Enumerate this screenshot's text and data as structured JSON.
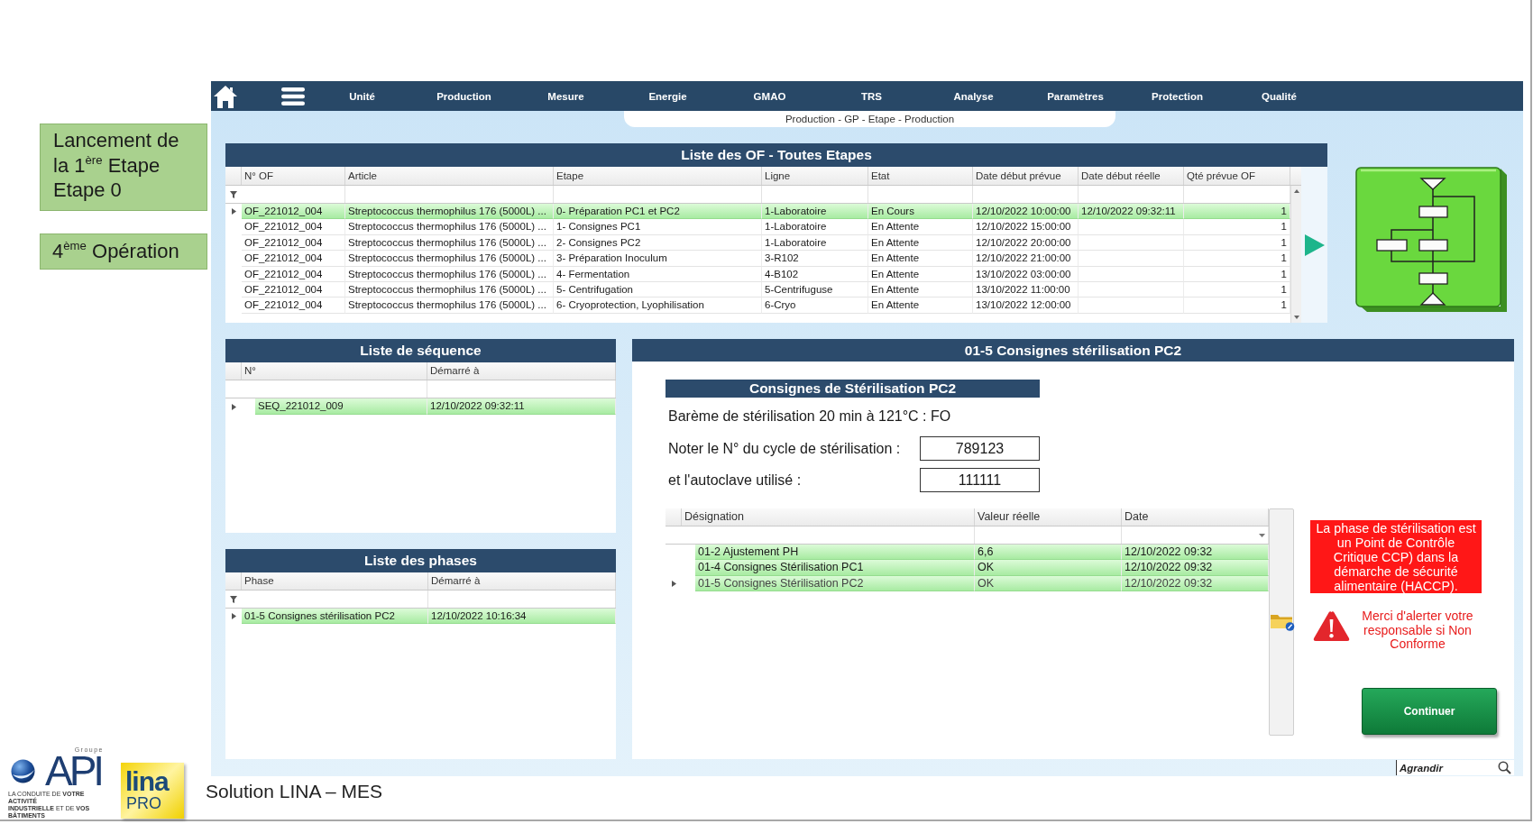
{
  "notes": {
    "step": {
      "title": "Lancement de la 1$^{ère}$ Etape",
      "subtitle": "Etape 0"
    },
    "operation": "4$^{ème}$ Opération"
  },
  "nav": {
    "items": [
      "Unité",
      "Production",
      "Mesure",
      "Energie",
      "GMAO",
      "TRS",
      "Analyse",
      "Paramètres",
      "Protection",
      "Qualité"
    ]
  },
  "breadcrumb": "Production - GP - Etape - Production",
  "of_list": {
    "title": "Liste des OF - Toutes Etapes",
    "columns": [
      "N° OF",
      "Article",
      "Etape",
      "Ligne",
      "Etat",
      "Date début prévue",
      "Date début réelle",
      "Qté prévue OF"
    ],
    "rows": [
      {
        "of": "OF_221012_004",
        "article": "Streptococcus thermophilus 176 (5000L) ...",
        "step": "0- Préparation PC1 et PC2",
        "line": "1-Laboratoire",
        "status": "En Cours",
        "planned_start": "12/10/2022 10:00:00",
        "actual_start": "12/10/2022 09:32:11",
        "planned_qty": "1",
        "selected": true
      },
      {
        "of": "OF_221012_004",
        "article": "Streptococcus thermophilus 176 (5000L) ...",
        "step": "1- Consignes PC1",
        "line": "1-Laboratoire",
        "status": "En Attente",
        "planned_start": "12/10/2022 15:00:00",
        "planned_qty": "1",
        "selected": false
      },
      {
        "of": "OF_221012_004",
        "article": "Streptococcus thermophilus 176 (5000L) ...",
        "step": "2- Consignes PC2",
        "line": "1-Laboratoire",
        "status": "En Attente",
        "planned_start": "12/10/2022 20:00:00",
        "planned_qty": "1",
        "selected": false
      },
      {
        "of": "OF_221012_004",
        "article": "Streptococcus thermophilus 176 (5000L) ...",
        "step": "3- Préparation Inoculum",
        "line": "3-R102",
        "status": "En Attente",
        "planned_start": "12/10/2022 21:00:00",
        "planned_qty": "1",
        "selected": false
      },
      {
        "of": "OF_221012_004",
        "article": "Streptococcus thermophilus 176 (5000L) ...",
        "step": "4- Fermentation",
        "line": "4-B102",
        "status": "En Attente",
        "planned_start": "13/10/2022 03:00:00",
        "planned_qty": "1",
        "selected": false
      },
      {
        "of": "OF_221012_004",
        "article": "Streptococcus thermophilus 176 (5000L) ...",
        "step": "5- Centrifugation",
        "line": "5-Centrifuguse",
        "status": "En Attente",
        "planned_start": "13/10/2022 11:00:00",
        "planned_qty": "1",
        "selected": false
      },
      {
        "of": "OF_221012_004",
        "article": "Streptococcus thermophilus 176 (5000L) ...",
        "step": "6- Cryoprotection, Lyophilisation",
        "line": "6-Cryo",
        "status": "En Attente",
        "planned_start": "13/10/2022 12:00:00",
        "planned_qty": "1",
        "selected": false
      }
    ]
  },
  "sequence_list": {
    "title": "Liste de séquence",
    "columns": [
      "N°",
      "Démarré à"
    ],
    "rows": [
      {
        "number": "SEQ_221012_009",
        "started": "12/10/2022 09:32:11",
        "selected": true
      }
    ]
  },
  "phase_list": {
    "title": "Liste des phases",
    "columns": [
      "Phase",
      "Démarré à"
    ],
    "rows": [
      {
        "phase": "01-5 Consignes stérilisation PC2",
        "started": "12/10/2022 10:16:34",
        "selected": true
      }
    ]
  },
  "phase_detail": {
    "title": "01-5 Consignes stérilisation PC2",
    "subtitle": "Consignes de Stérilisation PC2",
    "instruction": "Barème de stérilisation 20 min à 121°C : FO",
    "fields": [
      {
        "label": "Noter le N° du cycle de stérilisation :",
        "value": "789123"
      },
      {
        "label": "et l'autoclave utilisé :",
        "value": "111111"
      }
    ],
    "grid": {
      "columns": [
        "Désignation",
        "Valeur réelle",
        "Date"
      ],
      "rows": [
        {
          "designation": "01-2 Ajustement PH",
          "value": "6,6",
          "date": "12/10/2022 09:32",
          "validated": true,
          "selected": false
        },
        {
          "designation": "01-4 Consignes Stérilisation PC1",
          "value": "OK",
          "date": "12/10/2022 09:32",
          "validated": true,
          "selected": false
        },
        {
          "designation": "01-5 Consignes Stérilisation PC2",
          "value": "OK",
          "date": "12/10/2022 09:32",
          "validated": true,
          "selected": true
        }
      ]
    },
    "ccp_alert": "La phase de stérilisation est un Point de Contrôle Critique CCP) dans la démarche de sécurité alimentaire (HACCP).",
    "warning": "Merci d'alerter votre responsable si Non Conforme",
    "continue_button": "Continuer"
  },
  "zoom_button": "Agrandir",
  "footer": {
    "api_logo": {
      "group": "Groupe",
      "name": "API",
      "tagline": [
        "LA CONDUITE DE **VOTRE ACTIVITÉ**",
        "**INDUSTRIELLE** ET DE **VOS BÂTIMENTS**"
      ]
    },
    "lina_logo": {
      "name": "lina",
      "edition": "PRO"
    },
    "caption": "Solution LINA – MES"
  }
}
